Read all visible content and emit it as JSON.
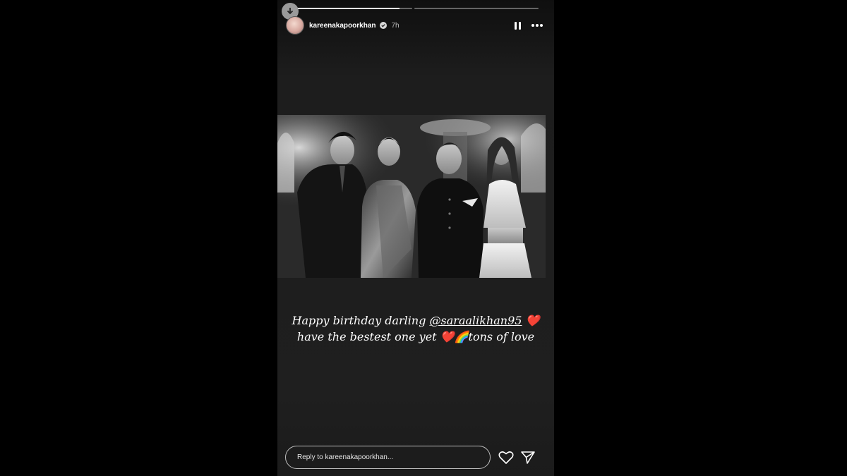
{
  "story": {
    "username": "kareenakapoorkhan",
    "time_ago": "7h",
    "verified": true,
    "progress": [
      0.9,
      0.0
    ],
    "caption_line1_prefix": "Happy birthday darling ",
    "caption_mention": "@saraalikhan95",
    "caption_line1_suffix": " ❤️",
    "caption_line2": "have the bestest one yet ❤️🌈tons of love"
  },
  "reply": {
    "placeholder": "Reply to kareenakapoorkhan..."
  },
  "icons": {
    "download": "download-icon",
    "pause": "pause-icon",
    "more": "more-options-icon",
    "like": "heart-icon",
    "send": "send-icon"
  },
  "colors": {
    "story_bg": "#1c1c1c",
    "page_bg": "#000000",
    "text": "#ffffff"
  }
}
